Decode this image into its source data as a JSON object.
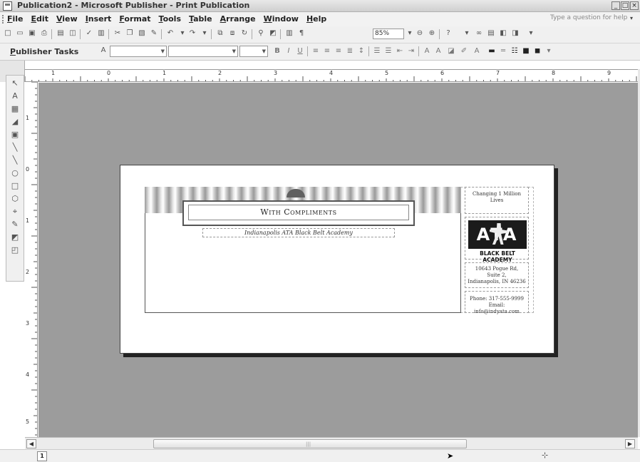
{
  "window": {
    "title": "Publication2 - Microsoft Publisher - Print Publication",
    "min": "_",
    "max": "□",
    "close": "×"
  },
  "menubar": {
    "items": [
      {
        "key": "F",
        "rest": "ile"
      },
      {
        "key": "E",
        "rest": "dit"
      },
      {
        "key": "V",
        "rest": "iew"
      },
      {
        "key": "I",
        "rest": "nsert"
      },
      {
        "key": "F",
        "rest": "ormat"
      },
      {
        "key": "T",
        "rest": "ools"
      },
      {
        "key": "T",
        "rest": "able"
      },
      {
        "key": "A",
        "rest": "rrange"
      },
      {
        "key": "W",
        "rest": "indow"
      },
      {
        "key": "H",
        "rest": "elp"
      }
    ],
    "ask_placeholder": "Type a question for help"
  },
  "toolbar": {
    "zoom_value": "85%"
  },
  "format_toolbar": {
    "tasks_key": "P",
    "tasks_rest": "ublisher Tasks"
  },
  "rulers": {
    "h_numbers": [
      "1",
      "0",
      "1",
      "2",
      "3",
      "4",
      "5",
      "6",
      "7",
      "8",
      "9"
    ],
    "v_numbers": [
      "1",
      "0",
      "1",
      "2",
      "3",
      "4",
      "5"
    ]
  },
  "publication": {
    "banner_text": "With Compliments",
    "academy_name": "Indianapolis ATA Black Belt Academy",
    "tagline": "Changing 1 Million Lives",
    "logo_mark": "ATA",
    "logo_caption": "BLACK BELT ACADEMY",
    "address_line1": "10643 Pogue Rd,",
    "address_line2": "Suite 2,",
    "address_line3": "Indianapolis, IN 46236",
    "phone": "Phone: 317-555-9999",
    "email": "Email: info@indyata.com"
  },
  "statusbar": {
    "page_number": "1"
  }
}
